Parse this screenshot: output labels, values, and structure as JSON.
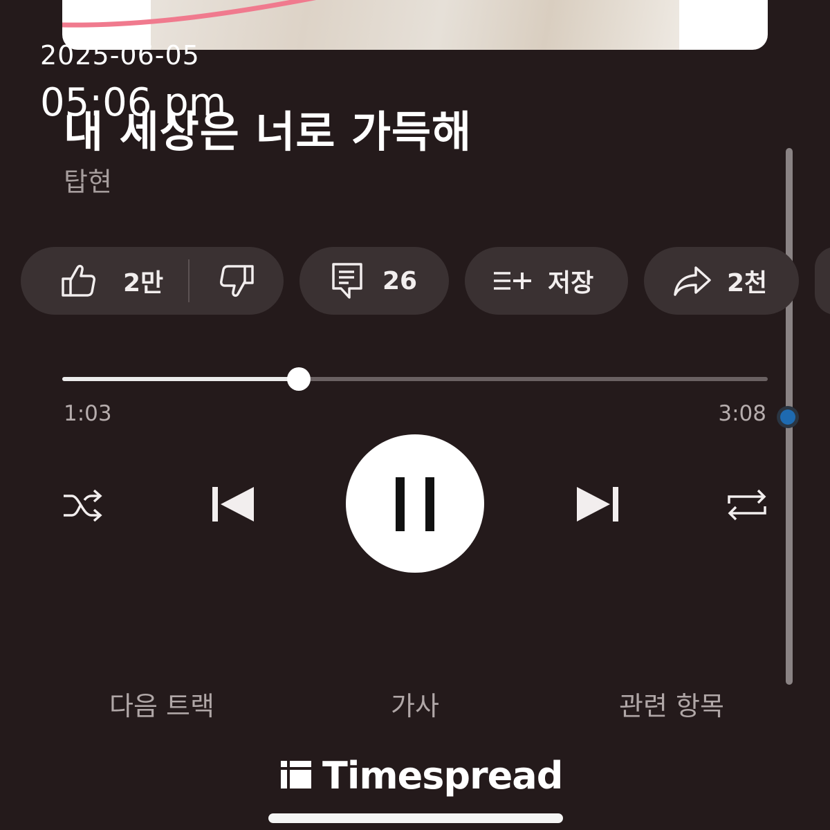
{
  "overlay": {
    "date": "2025-06-05",
    "time": "05:06 pm"
  },
  "song": {
    "title": "내 세상은 너로 가득해",
    "artist": "탑현"
  },
  "actions": {
    "likes": "2만",
    "comments": "26",
    "save_label": "저장",
    "shares": "2천"
  },
  "playback": {
    "elapsed": "1:03",
    "total": "3:08",
    "progress_fraction": 0.335,
    "state": "playing"
  },
  "tabs": {
    "next_track": "다음 트랙",
    "lyrics": "가사",
    "related": "관련 항목"
  },
  "watermark": {
    "brand": "Timespread"
  },
  "icons": {
    "like": "thumbs-up-icon",
    "dislike": "thumbs-down-icon",
    "comment": "comment-icon",
    "save": "playlist-add-icon",
    "share": "share-icon",
    "shuffle": "shuffle-icon",
    "previous": "skip-previous-icon",
    "pause": "pause-icon",
    "next": "skip-next-icon",
    "repeat": "repeat-icon"
  },
  "colors": {
    "background": "#241a1b",
    "chip": "#3a3132",
    "accent_scroll": "#1e6ab0",
    "art_curve": "#f07a8e"
  }
}
